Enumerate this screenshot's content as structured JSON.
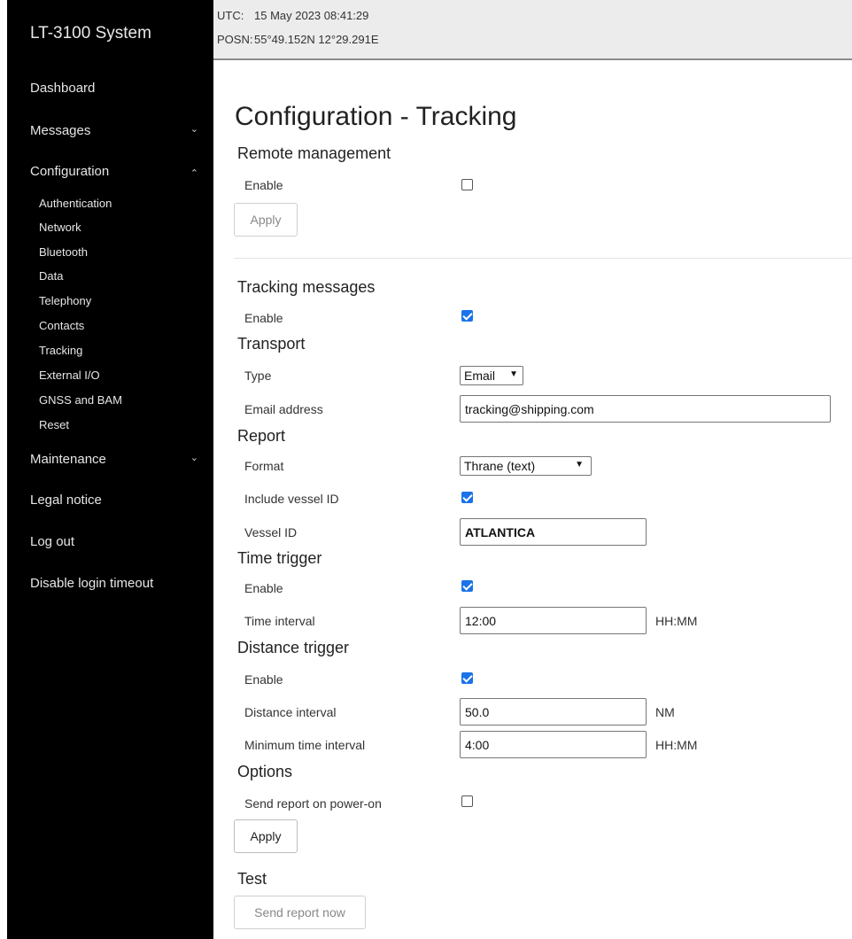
{
  "sidebar": {
    "brand": "LT-3100 System",
    "items": [
      {
        "label": "Dashboard"
      },
      {
        "label": "Messages",
        "chevron": "⌄"
      },
      {
        "label": "Configuration",
        "chevron": "⌃"
      },
      {
        "label": "Maintenance",
        "chevron": "⌄"
      },
      {
        "label": "Legal notice"
      },
      {
        "label": "Log out"
      },
      {
        "label": "Disable login timeout"
      }
    ],
    "config_subitems": [
      "Authentication",
      "Network",
      "Bluetooth",
      "Data",
      "Telephony",
      "Contacts",
      "Tracking",
      "External I/O",
      "GNSS and BAM",
      "Reset"
    ]
  },
  "status": {
    "utc_label": "UTC:",
    "utc_value": "15 May 2023 08:41:29",
    "posn_label": "POSN:",
    "posn_value": "55°49.152N 12°29.291E"
  },
  "main": {
    "title": "Configuration - Tracking",
    "remote": {
      "title": "Remote management",
      "enable_label": "Enable",
      "enable_checked": false,
      "apply_label": "Apply"
    },
    "tracking": {
      "title": "Tracking messages",
      "enable_label": "Enable",
      "enable_checked": true
    },
    "transport": {
      "title": "Transport",
      "type_label": "Type",
      "type_value": "Email",
      "email_label": "Email address",
      "email_value": "tracking@shipping.com"
    },
    "report": {
      "title": "Report",
      "format_label": "Format",
      "format_value": "Thrane (text)",
      "include_vessel_label": "Include vessel ID",
      "include_vessel_checked": true,
      "vessel_label": "Vessel ID",
      "vessel_value": "ATLANTICA"
    },
    "time_trigger": {
      "title": "Time trigger",
      "enable_label": "Enable",
      "enable_checked": true,
      "interval_label": "Time interval",
      "interval_value": "12:00",
      "interval_unit": "HH:MM"
    },
    "distance_trigger": {
      "title": "Distance trigger",
      "enable_label": "Enable",
      "enable_checked": true,
      "distance_label": "Distance interval",
      "distance_value": "50.0",
      "distance_unit": "NM",
      "min_time_label": "Minimum time interval",
      "min_time_value": "4:00",
      "min_time_unit": "HH:MM"
    },
    "options": {
      "title": "Options",
      "power_on_label": "Send report on power-on",
      "power_on_checked": false,
      "apply_label": "Apply"
    },
    "test": {
      "title": "Test",
      "send_label": "Send report now"
    }
  },
  "colors": {
    "sidebar_bg": "#000000",
    "header_bg": "#ececec",
    "checkbox_accent": "#1a73e8"
  }
}
